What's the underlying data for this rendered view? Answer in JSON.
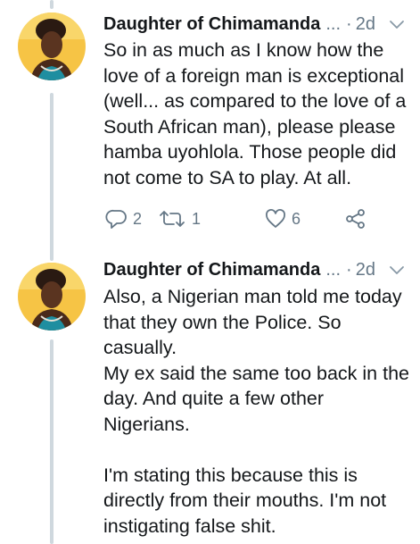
{
  "tweets": [
    {
      "author": "Daughter of Chimamanda",
      "ellipsis": "...",
      "separator": "·",
      "time": "2d",
      "avatar_icon": "avatar-photo",
      "paragraphs": [
        "So in as much as I know how the love of a foreign man is exceptional (well... as compared to the love of a South African man), please please hamba uyohlola. Those people did not come to SA to play. At all."
      ],
      "actions": {
        "reply_count": "2",
        "retweet_count": "1",
        "like_count": "6"
      }
    },
    {
      "author": "Daughter of Chimamanda",
      "ellipsis": "...",
      "separator": "·",
      "time": "2d",
      "avatar_icon": "avatar-photo",
      "paragraphs": [
        "Also, a Nigerian man told me today that they own the Police. So casually.",
        "My ex said the same too back in the day. And quite a few other Nigerians.",
        "",
        "I'm stating this because this is directly from their mouths. I'm not instigating false shit."
      ]
    }
  ],
  "colors": {
    "thread_line": "#cfd8de",
    "muted": "#657786",
    "avatar_bg": "#f6c445",
    "text": "#14171a"
  }
}
